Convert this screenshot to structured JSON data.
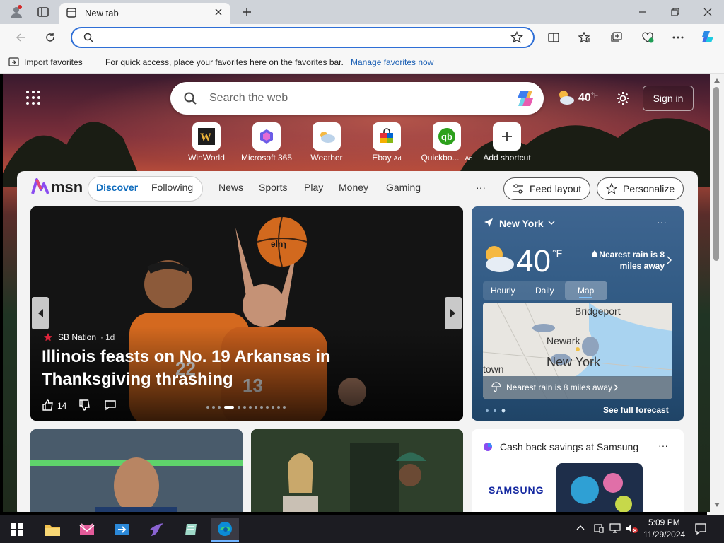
{
  "browser": {
    "tab_title": "New tab",
    "address_value": "",
    "favorites_bar": {
      "import_label": "Import favorites",
      "hint": "For quick access, place your favorites here on the favorites bar.",
      "manage_link": "Manage favorites now"
    }
  },
  "ntp": {
    "search_placeholder": "Search the web",
    "weather_temp": "40",
    "weather_unit": "°F",
    "signin_label": "Sign in",
    "shortcuts": [
      {
        "label": "WinWorld",
        "ad": ""
      },
      {
        "label": "Microsoft 365",
        "ad": ""
      },
      {
        "label": "Weather",
        "ad": ""
      },
      {
        "label": "Ebay",
        "ad": "Ad"
      },
      {
        "label": "Quickbo...",
        "ad": "Ad"
      },
      {
        "label": "Add shortcut",
        "ad": ""
      }
    ]
  },
  "feed": {
    "brand": "msn",
    "tabs": [
      "Discover",
      "Following"
    ],
    "nav": [
      "News",
      "Sports",
      "Play",
      "Money",
      "Gaming"
    ],
    "more": "···",
    "feed_layout_label": "Feed layout",
    "personalize_label": "Personalize",
    "hero": {
      "source": "SB Nation",
      "age": "1d",
      "headline": "Illinois feasts on No. 19 Arkansas in Thanksgiving thrashing",
      "likes": "14",
      "jersey_a": "22",
      "jersey_b": "13",
      "ball_text": "ɘlnɿ"
    },
    "weather": {
      "location": "New York",
      "temp": "40",
      "unit": "°F",
      "rain_note": "Nearest rain is 8 miles away",
      "tabs": [
        "Hourly",
        "Daily",
        "Map"
      ],
      "map_labels": {
        "bridgeport": "Bridgeport",
        "newark": "Newark",
        "newyork": "New York",
        "town": "town"
      },
      "map_rain": "Nearest rain is 8 miles away",
      "forecast_link": "See full forecast"
    },
    "promo": {
      "title": "Cash back savings at Samsung",
      "brand": "SAMSUNG"
    }
  },
  "taskbar": {
    "time": "5:09 PM",
    "date": "11/29/2024"
  },
  "colors": {
    "accent": "#2f6fd6",
    "msn_blue": "#0f6cbd",
    "taskbar": "#1c1c22"
  }
}
